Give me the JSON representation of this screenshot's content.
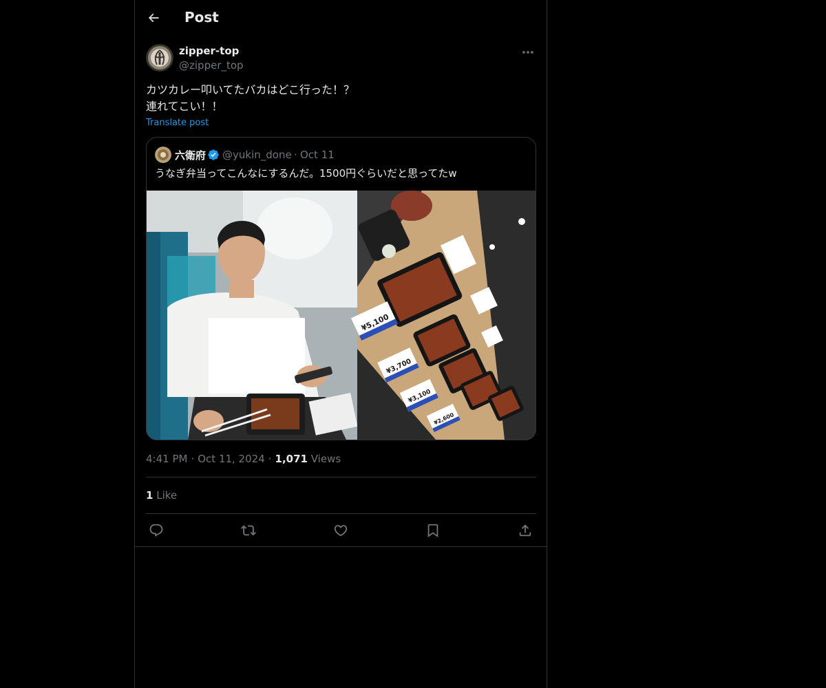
{
  "header": {
    "title": "Post"
  },
  "post": {
    "author": {
      "display_name": "zipper-top",
      "handle": "@zipper_top"
    },
    "text_lines": [
      "カツカレー叩いてたバカはどこ行った！？",
      "連れてこい！！"
    ],
    "translate_label": "Translate post",
    "quoted": {
      "display_name": "六衛府",
      "handle": "@yukin_done",
      "separator": "·",
      "date": "Oct 11",
      "text": "うなぎ弁当ってこんなにするんだ。1500円ぐらいだと思ってたw",
      "media_price_labels": [
        "¥5,100",
        "¥3,700",
        "¥3,100",
        "¥2,600"
      ]
    },
    "meta": {
      "time": "4:41 PM",
      "separator": "·",
      "date": "Oct 11, 2024",
      "views_count": "1,071",
      "views_label": "Views"
    },
    "likes": {
      "count": "1",
      "label": "Like"
    }
  },
  "icons": [
    "back-arrow-icon",
    "more-icon",
    "verified-icon",
    "reply-icon",
    "repost-icon",
    "like-icon",
    "bookmark-icon",
    "share-icon"
  ],
  "colors": {
    "background": "#000000",
    "text": "#e7e9ea",
    "secondary": "#71767b",
    "accent": "#1d9bf0",
    "border": "#2f3336"
  }
}
